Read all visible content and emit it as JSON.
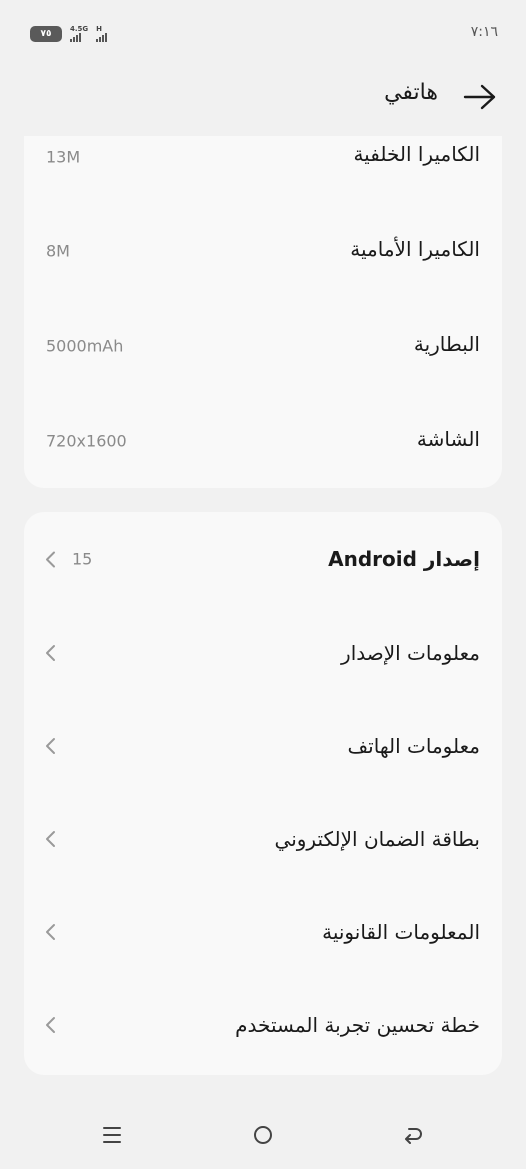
{
  "status_bar": {
    "battery": "٧٥",
    "network_1": "4.5G",
    "network_2": "H",
    "time": "٧:١٦"
  },
  "header": {
    "title": "هاتفي",
    "back_icon": "arrow-right-icon"
  },
  "specs": [
    {
      "label": "الكاميرا الخلفية",
      "value": "13M"
    },
    {
      "label": "الكاميرا الأمامية",
      "value": "8M"
    },
    {
      "label": "البطارية",
      "value": "5000mAh"
    },
    {
      "label": "الشاشة",
      "value": "720x1600"
    }
  ],
  "menu": [
    {
      "label": "إصدار Android",
      "value": "15",
      "icon": "chevron-left-icon"
    },
    {
      "label": "معلومات الإصدار",
      "icon": "chevron-left-icon"
    },
    {
      "label": "معلومات الهاتف",
      "icon": "chevron-left-icon"
    },
    {
      "label": "بطاقة الضمان الإلكتروني",
      "icon": "chevron-left-icon"
    },
    {
      "label": "المعلومات القانونية",
      "icon": "chevron-left-icon"
    },
    {
      "label": "خطة تحسين تجربة المستخدم",
      "icon": "chevron-left-icon"
    }
  ],
  "nav_bar": {
    "menu_icon": "menu-icon",
    "home_icon": "home-circle-icon",
    "back_icon": "back-return-icon"
  }
}
